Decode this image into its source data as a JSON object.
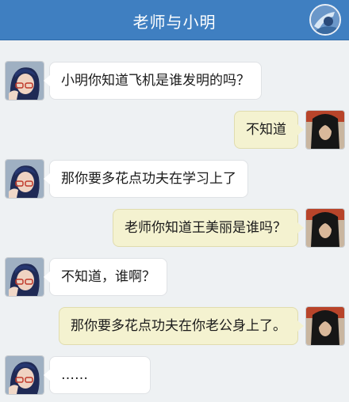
{
  "header": {
    "title": "老师与小明",
    "avatar_icon": "profile-avatar-icon"
  },
  "messages": [
    {
      "sender": "teacher",
      "text": "小明你知道飞机是谁发明的吗？"
    },
    {
      "sender": "student",
      "text": "不知道"
    },
    {
      "sender": "teacher",
      "text": "那你要多花点功夫在学习上了"
    },
    {
      "sender": "student",
      "text": "老师你知道王美丽是谁吗？"
    },
    {
      "sender": "teacher",
      "text": "不知道，谁啊？"
    },
    {
      "sender": "student",
      "text": "那你要多花点功夫在你老公身上了。"
    },
    {
      "sender": "teacher",
      "text": "……"
    }
  ],
  "colors": {
    "header_bg": "#3f7fc1",
    "teacher_bubble": "#ffffff",
    "student_bubble": "#f4f2d0",
    "background": "#eef1f3"
  }
}
